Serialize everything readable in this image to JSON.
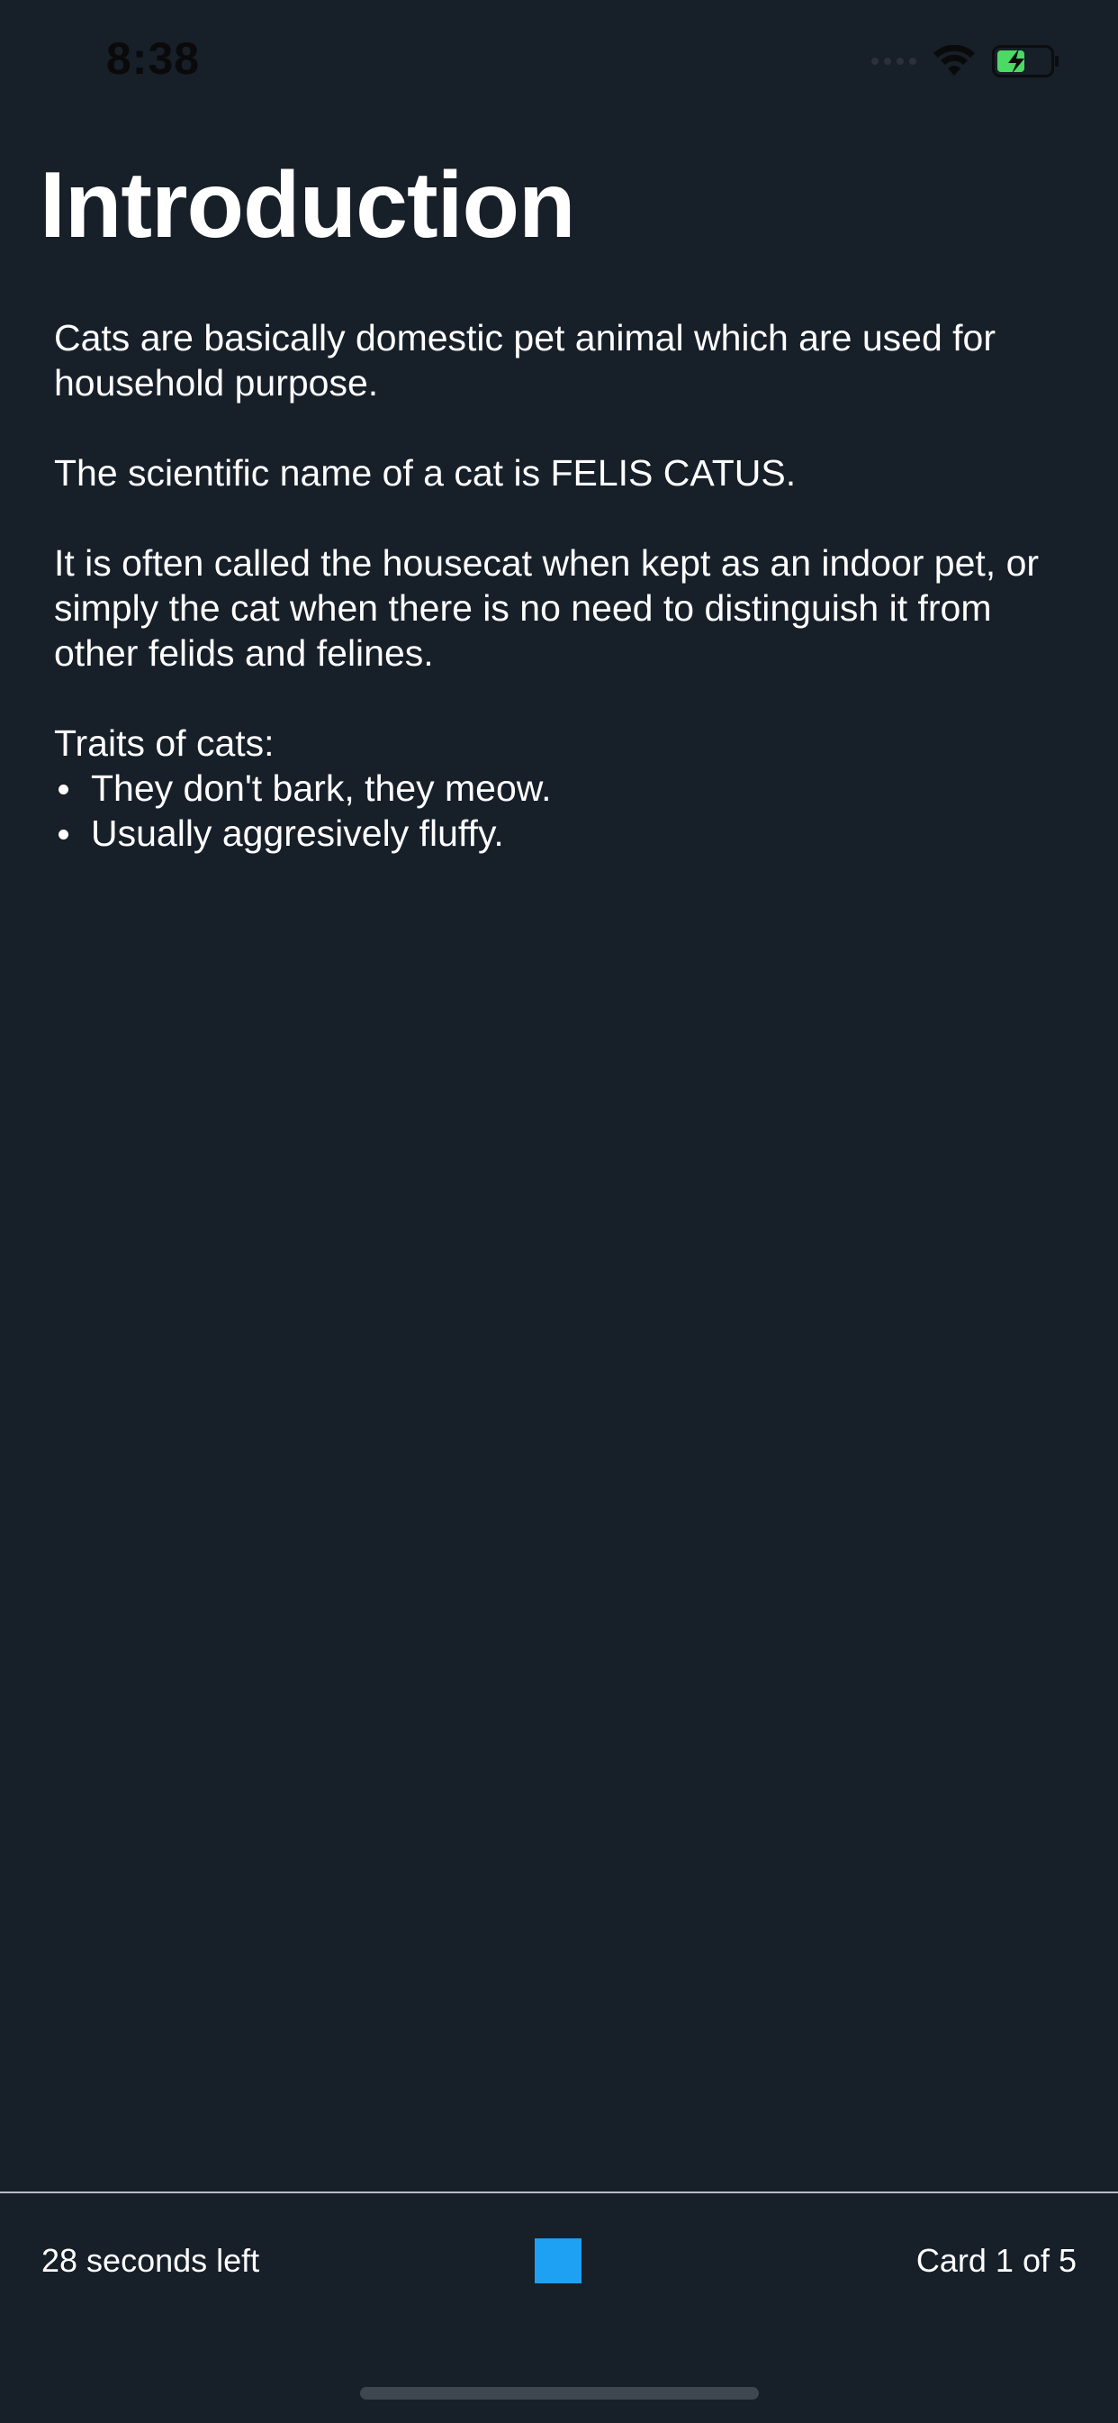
{
  "status_bar": {
    "time": "8:38",
    "icons": [
      "signal-icon",
      "wifi-icon",
      "battery-charging-icon"
    ],
    "battery_color": "#4cd964"
  },
  "card": {
    "title": "Introduction",
    "paragraphs": [
      "Cats are basically domestic pet animal which are used for household purpose.",
      "The scientific name of a cat is FELIS CATUS.",
      "It is often called the housecat when kept as an indoor pet, or simply the cat when there is no need to distinguish it from other felids and felines."
    ],
    "traits_heading": "Traits of cats:",
    "traits": [
      "They don't bark, they meow.",
      "Usually aggresively fluffy."
    ]
  },
  "footer": {
    "timer_text": "28 seconds left",
    "counter_text": "Card 1 of 5",
    "accent_color": "#1ea1f2"
  },
  "colors": {
    "background": "#171f29",
    "text": "#ffffff"
  }
}
